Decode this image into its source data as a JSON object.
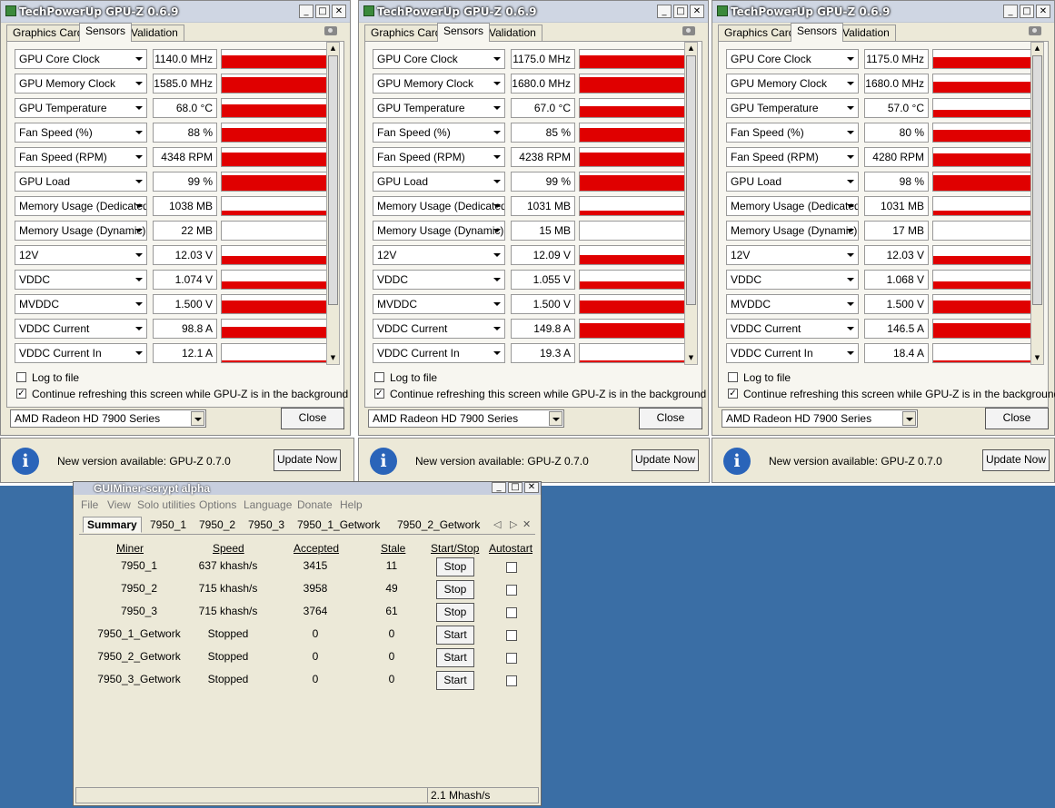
{
  "gpuz": {
    "title": "TechPowerUp GPU-Z 0.6.9",
    "tabs": [
      "Graphics Card",
      "Sensors",
      "Validation"
    ],
    "log_to_file": "Log to file",
    "continue_refreshing": "Continue refreshing this screen while GPU-Z is in the background",
    "device": "AMD Radeon HD 7900 Series",
    "close_label": "Close",
    "notice_text": "New version available: GPU-Z 0.7.0",
    "update_label": "Update Now",
    "sensor_names": [
      "GPU Core Clock",
      "GPU Memory Clock",
      "GPU Temperature",
      "Fan Speed (%)",
      "Fan Speed (RPM)",
      "GPU Load",
      "Memory Usage (Dedicated)",
      "Memory Usage (Dynamic)",
      "12V",
      "VDDC",
      "MVDDC",
      "VDDC Current",
      "VDDC Current In"
    ],
    "windows": [
      {
        "values": [
          "1140.0 MHz",
          "1585.0 MHz",
          "68.0 °C",
          "88 %",
          "4348 RPM",
          "99 %",
          "1038 MB",
          "22 MB",
          "12.03 V",
          "1.074 V",
          "1.500 V",
          "98.8 A",
          "12.1 A"
        ],
        "levels": [
          0.72,
          0.85,
          0.7,
          0.75,
          0.75,
          0.85,
          0.25,
          0.0,
          0.45,
          0.4,
          0.7,
          0.6,
          0.1
        ]
      },
      {
        "values": [
          "1175.0 MHz",
          "1680.0 MHz",
          "67.0 °C",
          "85 %",
          "4238 RPM",
          "99 %",
          "1031 MB",
          "15 MB",
          "12.09 V",
          "1.055 V",
          "1.500 V",
          "149.8 A",
          "19.3 A"
        ],
        "levels": [
          0.72,
          0.85,
          0.6,
          0.75,
          0.75,
          0.85,
          0.25,
          0.0,
          0.5,
          0.4,
          0.7,
          0.8,
          0.12
        ]
      },
      {
        "values": [
          "1175.0 MHz",
          "1680.0 MHz",
          "57.0 °C",
          "80 %",
          "4280 RPM",
          "98 %",
          "1031 MB",
          "17 MB",
          "12.03 V",
          "1.068 V",
          "1.500 V",
          "146.5 A",
          "18.4 A"
        ],
        "levels": [
          0.6,
          0.6,
          0.4,
          0.65,
          0.7,
          0.85,
          0.25,
          0.0,
          0.45,
          0.4,
          0.7,
          0.8,
          0.12
        ]
      }
    ]
  },
  "miner": {
    "title": "GUIMiner-scrypt alpha",
    "menu": [
      "File",
      "View",
      "Solo utilities",
      "Options",
      "Language",
      "Donate",
      "Help"
    ],
    "tabs": [
      "Summary",
      "7950_1",
      "7950_2",
      "7950_3",
      "7950_1_Getwork",
      "7950_2_Getwork"
    ],
    "headers": [
      "Miner",
      "Speed",
      "Accepted",
      "Stale",
      "Start/Stop",
      "Autostart"
    ],
    "rows": [
      {
        "miner": "7950_1",
        "speed": "637 khash/s",
        "accepted": "3415",
        "stale": "11",
        "action": "Stop"
      },
      {
        "miner": "7950_2",
        "speed": "715 khash/s",
        "accepted": "3958",
        "stale": "49",
        "action": "Stop"
      },
      {
        "miner": "7950_3",
        "speed": "715 khash/s",
        "accepted": "3764",
        "stale": "61",
        "action": "Stop"
      },
      {
        "miner": "7950_1_Getwork",
        "speed": "Stopped",
        "accepted": "0",
        "stale": "0",
        "action": "Start"
      },
      {
        "miner": "7950_2_Getwork",
        "speed": "Stopped",
        "accepted": "0",
        "stale": "0",
        "action": "Start"
      },
      {
        "miner": "7950_3_Getwork",
        "speed": "Stopped",
        "accepted": "0",
        "stale": "0",
        "action": "Start"
      }
    ],
    "total_speed": "2.1 Mhash/s"
  }
}
